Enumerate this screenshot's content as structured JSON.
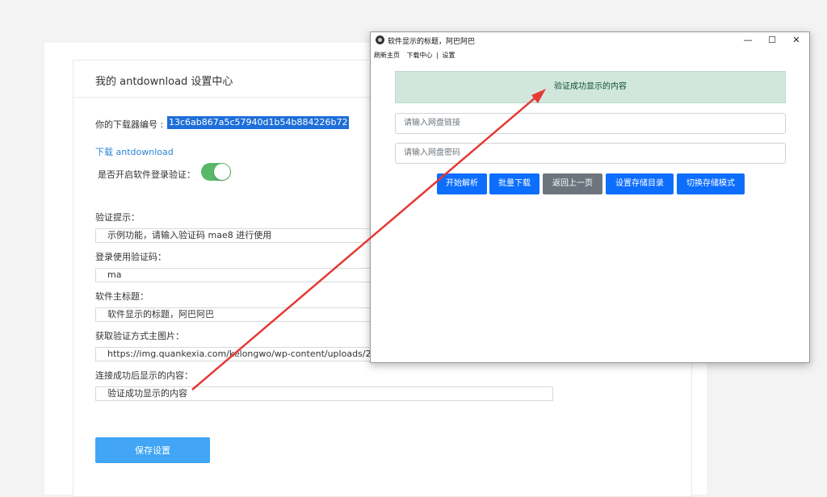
{
  "settings": {
    "title": "我的 antdownload 设置中心",
    "device_id_label": "你的下载器编号 :",
    "device_id": "13c6ab867a5c57940d1b54b884226b72",
    "download_link": "下载 antdownload",
    "login_verify_label": "是否开启软件登录验证：",
    "login_verify_enabled": true,
    "verify_hint_label": "验证提示：",
    "verify_hint_value": "示例功能，请输入验证码 mae8 进行使用",
    "login_code_label": "登录使用验证码：",
    "login_code_value": "ma",
    "main_title_label": "软件主标题：",
    "main_title_value": "软件显示的标题，阿巴阿巴",
    "image_label": "获取验证方式主图片：",
    "image_value": "https://img.quankexia.com/kelongwo/wp-content/uploads/2022/0",
    "success_content_label": "连接成功后显示的内容：",
    "success_content_value": "验证成功显示的内容",
    "save_label": "保存设置"
  },
  "window": {
    "title": "软件显示的标题，阿巴阿巴",
    "controls": {
      "minimize": "—",
      "maximize": "☐",
      "close": "✕"
    },
    "menu": [
      "刷新主页",
      "下载中心",
      "|",
      "设置"
    ],
    "success_banner": "验证成功显示的内容",
    "link_placeholder": "请输入网盘链接",
    "password_placeholder": "请输入网盘密码",
    "buttons": {
      "parse": "开始解析",
      "batch_download": "批量下载",
      "back": "返回上一页",
      "set_dir": "设置存储目录",
      "switch_mode": "切换存储模式"
    }
  },
  "colors": {
    "annotation_arrow": "#e53935",
    "toggle_on": "#58b86a",
    "primary_button": "#0d6efd",
    "save_button": "#42a5f5"
  }
}
